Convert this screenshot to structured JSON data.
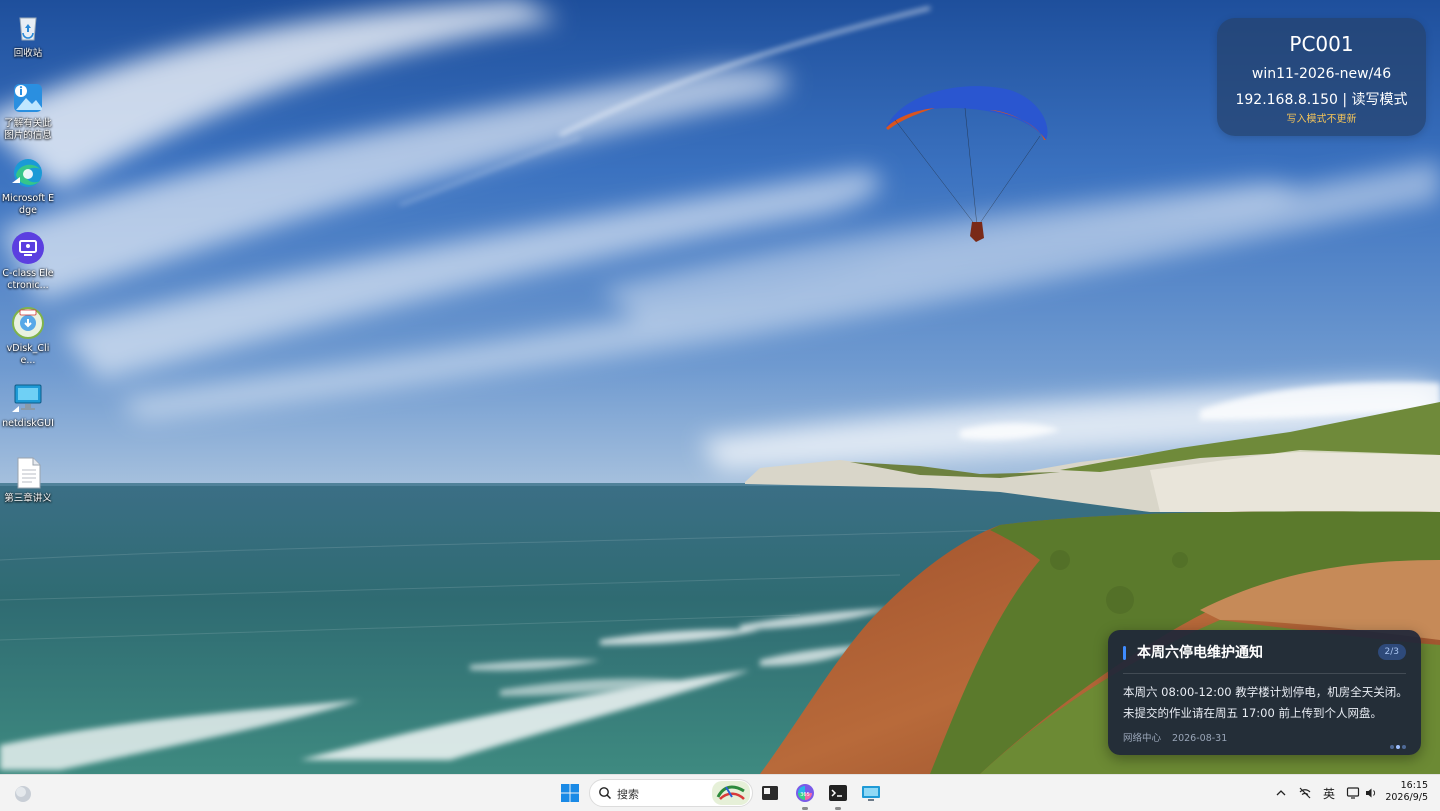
{
  "desktop": {
    "icons": [
      {
        "label": "回收站",
        "icon": "recycle-bin-icon"
      },
      {
        "label": "了解有关此图片的信息",
        "icon": "picture-info-icon"
      },
      {
        "label": "Microsoft Edge",
        "icon": "edge-icon"
      },
      {
        "label": "C-class Electronic...",
        "icon": "classroom-monitor-icon"
      },
      {
        "label": "vDisk_Clie...",
        "icon": "vdisk-icon"
      },
      {
        "label": "netdiskGUI",
        "icon": "netdisk-monitor-icon"
      },
      {
        "label": "第三章讲义",
        "icon": "document-icon"
      }
    ]
  },
  "pc_widget": {
    "name": "PC001",
    "image": "win11-2026-new/46",
    "ip_mode": "192.168.8.150 | 读写模式",
    "note": "写入模式不更新"
  },
  "notice": {
    "title": "本周六停电维护通知",
    "pager": "2/3",
    "lines": [
      "本周六 08:00-12:00 教学楼计划停电，机房全天关闭。",
      "未提交的作业请在周五 17:00 前上传到个人网盘。"
    ],
    "source": "网络中心",
    "date": "2026-08-31",
    "page_index": 2,
    "page_total": 3
  },
  "taskbar": {
    "search_placeholder": "搜索",
    "apps": [
      "start-icon",
      "file-explorer-icon",
      "m365-copilot-icon",
      "terminal-icon",
      "remote-desktop-icon"
    ],
    "ime": "英",
    "time": "16:15",
    "date": "2026/9/5"
  },
  "colors": {
    "accent": "#3f8cff",
    "widget_note": "#f2c35a"
  }
}
